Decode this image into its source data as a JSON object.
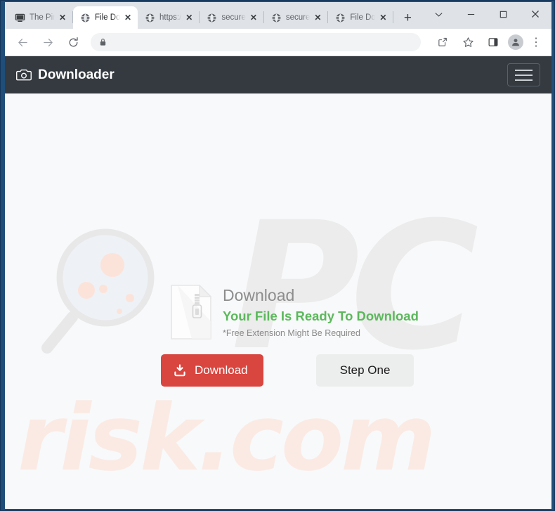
{
  "browser": {
    "tabs": [
      {
        "title": "The Pir",
        "favicon": "monitor-icon",
        "active": false
      },
      {
        "title": "File Do",
        "favicon": "globe-icon",
        "active": true
      },
      {
        "title": "https:/",
        "favicon": "globe-icon",
        "active": false
      },
      {
        "title": "secure",
        "favicon": "globe-icon",
        "active": false
      },
      {
        "title": "secure",
        "favicon": "globe-icon",
        "active": false
      },
      {
        "title": "File Do",
        "favicon": "globe-icon",
        "active": false
      }
    ],
    "new_tab_label": "+",
    "close_label": "✕",
    "window_controls": {
      "tab_search": "⌄",
      "minimize": "─",
      "maximize": "□",
      "close": "✕"
    },
    "toolbar": {
      "back": "back-arrow",
      "forward": "forward-arrow",
      "reload": "reload-icon",
      "address_value": "",
      "address_placeholder": "",
      "lock": "lock-icon",
      "share": "share-icon",
      "bookmark": "star-icon",
      "side_panel": "side-panel-icon",
      "profile": "profile-icon",
      "menu": "⋮"
    }
  },
  "site": {
    "header": {
      "brand": "Downloader",
      "brand_icon": "camera-icon",
      "menu_button": "hamburger-icon"
    },
    "watermarks": {
      "magnifier": "magnifier-icon",
      "pc": "PC",
      "risk": "risk.com"
    },
    "download_card": {
      "file_icon": "zip-file-icon",
      "title": "Download",
      "ready_text": "Your File Is Ready To Download",
      "note": "*Free Extension Might Be Required"
    },
    "buttons": {
      "download_label": "Download",
      "download_icon": "download-arrow-icon",
      "step_label": "Step One"
    }
  },
  "colors": {
    "window_border": "#1f4e79",
    "header_bg": "#343a40",
    "page_bg": "#f8f9fa",
    "accent_red": "#d9453f",
    "accent_green": "#5cb85c",
    "step_bg": "#eceded",
    "watermark_gray": "#ececec",
    "watermark_pink": "#fbeae4"
  }
}
